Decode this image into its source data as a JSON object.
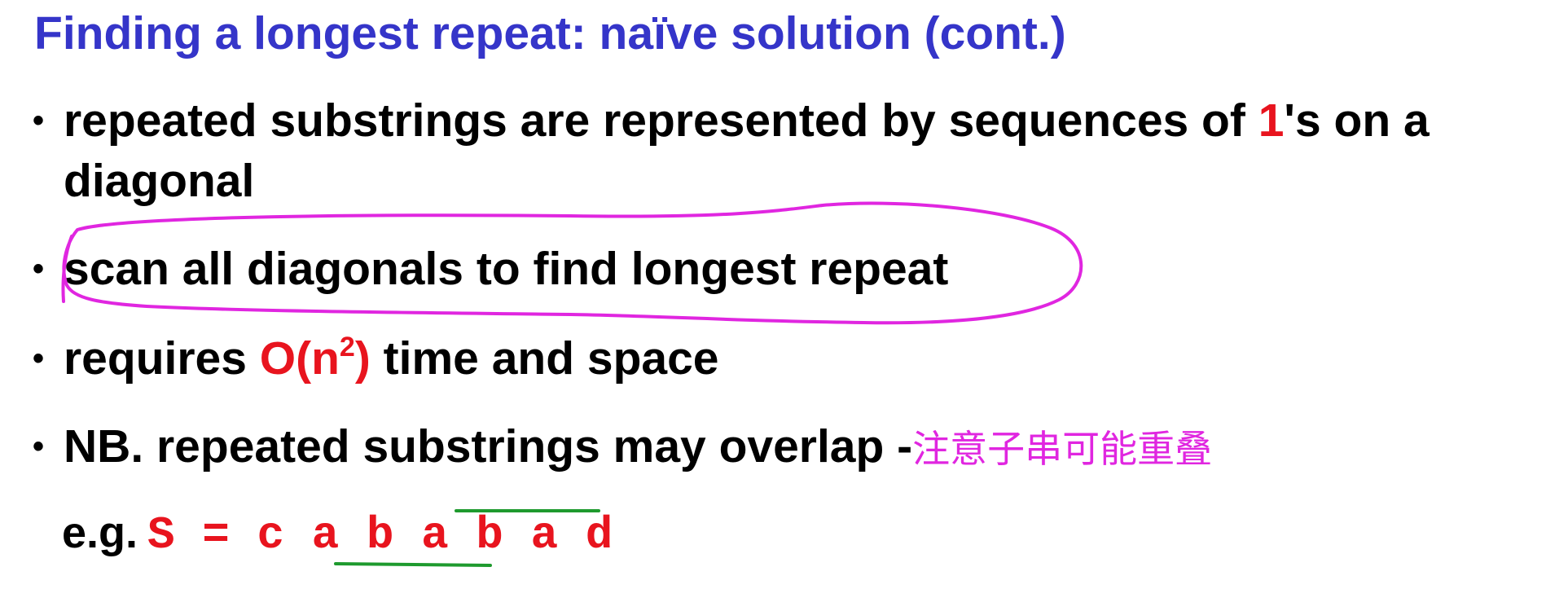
{
  "slide": {
    "title": "Finding a longest repeat: naïve solution (cont.)"
  },
  "bullets": {
    "b1": {
      "symbol": "•",
      "text_a": "repeated substrings are represented by sequences of ",
      "highlight": "1",
      "text_b": "'s on a",
      "continuation": "diagonal"
    },
    "b2": {
      "symbol": "•",
      "text": "scan all diagonals to find longest repeat"
    },
    "b3": {
      "symbol": "•",
      "text_a": "requires ",
      "complexity_base": "O(n",
      "complexity_exp": "2",
      "complexity_end": ")",
      "text_b": " time and space"
    },
    "b4": {
      "symbol": "•",
      "text": "NB. repeated substrings may overlap -",
      "annotation": "注意子串可能重叠"
    }
  },
  "example": {
    "prefix": "e.g.",
    "expression": "S = c a b a b a d"
  },
  "annotations": {
    "circle_color": "#e026e0",
    "underline_color": "#1e9a2e",
    "annotation_text_color": "#e026e0"
  },
  "colors": {
    "title": "#3535c9",
    "body": "#000000",
    "emphasis": "#e8141e"
  }
}
